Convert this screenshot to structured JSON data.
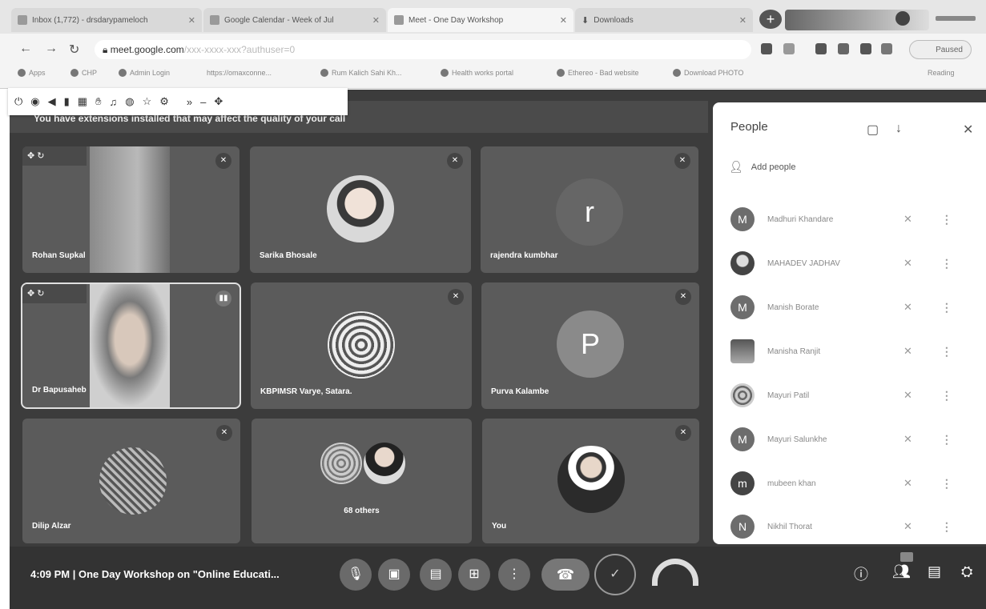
{
  "browser": {
    "tabs": [
      {
        "label": "Inbox (1,772) - drsdarypameloch"
      },
      {
        "label": "Google Calendar - Week of Jul"
      },
      {
        "label": "Meet - One Day Workshop"
      },
      {
        "label": "Downloads"
      }
    ],
    "url_host": "meet.google.com",
    "url_rest": "/xxx-xxxx-xxx?authuser=0",
    "paused_label": "Paused",
    "bookmarks": [
      "Apps",
      "CHP",
      "Admin Login",
      "https://omaxconne...",
      "Rum Kalich Sahi Kh...",
      "Health works portal",
      "Ethereo - Bad website",
      "Download PHOTO",
      "Reading"
    ]
  },
  "overlay_toolbar": {
    "icons": [
      "power",
      "eye",
      "speaker",
      "trash",
      "gallery",
      "hand",
      "mic",
      "stop",
      "star",
      "gear",
      "chevron",
      "minimize",
      "move"
    ]
  },
  "meet": {
    "banner": "You have extensions installed that may affect the quality of your call",
    "tiles": [
      {
        "name": "Rohan Supkal",
        "type": "video",
        "pinned": true
      },
      {
        "name": "Sarika Bhosale",
        "type": "photo"
      },
      {
        "name": "rajendra kumbhar",
        "type": "letter",
        "letter": "r"
      },
      {
        "name": "Dr Bapusaheb",
        "type": "video",
        "pinned": true,
        "speaking": true
      },
      {
        "name": "KBPIMSR Varye, Satara.",
        "type": "photo"
      },
      {
        "name": "Purva Kalambe",
        "type": "letter",
        "letter": "P"
      },
      {
        "name": "Dilip Alzar",
        "type": "photo"
      },
      {
        "name": "68 others",
        "type": "group"
      },
      {
        "name": "You",
        "type": "photo"
      }
    ],
    "meeting_info": "4:09 PM  |  One Day Workshop on \"Online Educati...",
    "controls": [
      "mic-off",
      "camera-off",
      "captions",
      "present",
      "more-options",
      "leave-call",
      "check",
      "gauge"
    ]
  },
  "people_panel": {
    "title": "People",
    "add_people": "Add people",
    "participants": [
      {
        "initial": "M",
        "name": "Madhuri Khandare"
      },
      {
        "initial": "",
        "name": "MAHADEV JADHAV"
      },
      {
        "initial": "M",
        "name": "Manish Borate"
      },
      {
        "initial": "",
        "name": "Manisha Ranjit"
      },
      {
        "initial": "",
        "name": "Mayuri Patil"
      },
      {
        "initial": "M",
        "name": "Mayuri Salunkhe"
      },
      {
        "initial": "m",
        "name": "mubeen khan"
      },
      {
        "initial": "N",
        "name": "Nikhil Thorat"
      }
    ]
  }
}
